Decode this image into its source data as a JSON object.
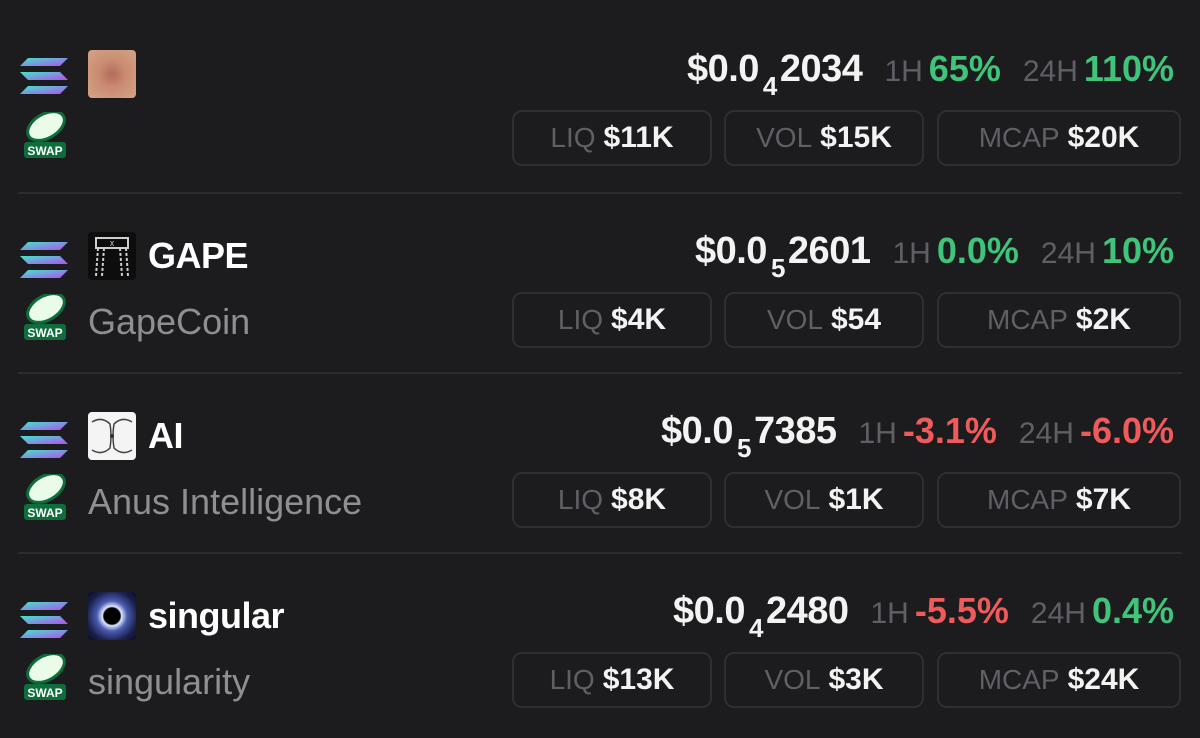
{
  "tokens": [
    {
      "symbol": "",
      "name": "",
      "chain_icon": "solana-icon",
      "swap_label": "SWAP",
      "price_prefix": "$0.0",
      "price_zero_count": "4",
      "price_digits": "2034",
      "h1_label": "1H",
      "h1_change": "65%",
      "h1_direction": "up",
      "h24_label": "24H",
      "h24_change": "110%",
      "h24_direction": "up",
      "liq_label": "LIQ",
      "liq_value": "$11K",
      "vol_label": "VOL",
      "vol_value": "$15K",
      "mcap_label": "MCAP",
      "mcap_value": "$20K"
    },
    {
      "symbol": "GAPE",
      "name": "GapeCoin",
      "chain_icon": "solana-icon",
      "swap_label": "SWAP",
      "price_prefix": "$0.0",
      "price_zero_count": "5",
      "price_digits": "2601",
      "h1_label": "1H",
      "h1_change": "0.0%",
      "h1_direction": "up",
      "h24_label": "24H",
      "h24_change": "10%",
      "h24_direction": "up",
      "liq_label": "LIQ",
      "liq_value": "$4K",
      "vol_label": "VOL",
      "vol_value": "$54",
      "mcap_label": "MCAP",
      "mcap_value": "$2K"
    },
    {
      "symbol": "AI",
      "name": "Anus Intelligence",
      "chain_icon": "solana-icon",
      "swap_label": "SWAP",
      "price_prefix": "$0.0",
      "price_zero_count": "5",
      "price_digits": "7385",
      "h1_label": "1H",
      "h1_change": "-3.1%",
      "h1_direction": "down",
      "h24_label": "24H",
      "h24_change": "-6.0%",
      "h24_direction": "down",
      "liq_label": "LIQ",
      "liq_value": "$8K",
      "vol_label": "VOL",
      "vol_value": "$1K",
      "mcap_label": "MCAP",
      "mcap_value": "$7K"
    },
    {
      "symbol": "singular",
      "name": "singularity",
      "chain_icon": "solana-icon",
      "swap_label": "SWAP",
      "price_prefix": "$0.0",
      "price_zero_count": "4",
      "price_digits": "2480",
      "h1_label": "1H",
      "h1_change": "-5.5%",
      "h1_direction": "down",
      "h24_label": "24H",
      "h24_change": "0.4%",
      "h24_direction": "up",
      "liq_label": "LIQ",
      "liq_value": "$13K",
      "vol_label": "VOL",
      "vol_value": "$3K",
      "mcap_label": "MCAP",
      "mcap_value": "$24K"
    }
  ],
  "colors": {
    "background": "#1c1c1f",
    "up": "#3fc47a",
    "down": "#ef5b5b",
    "muted": "#5f5f66"
  }
}
